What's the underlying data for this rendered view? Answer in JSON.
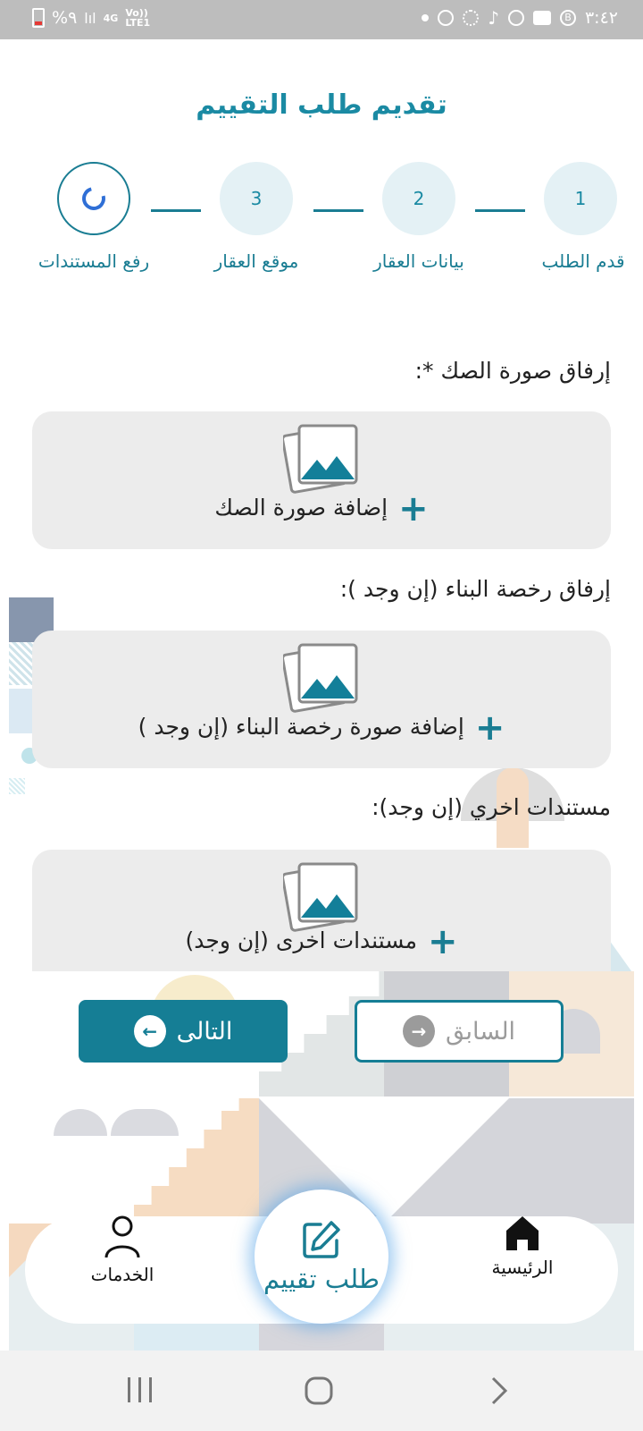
{
  "status_bar": {
    "time": "٣:٤٢",
    "battery": "%٩",
    "network_top": "4G",
    "network_bottom": "Vo)) LTE1"
  },
  "page": {
    "title": "تقديم طلب التقييم"
  },
  "stepper": {
    "steps": [
      {
        "number": "1",
        "label": "قدم الطلب"
      },
      {
        "number": "2",
        "label": "بيانات العقار"
      },
      {
        "number": "3",
        "label": "موقع العقار"
      },
      {
        "number": "",
        "label": "رفع المستندات"
      }
    ]
  },
  "uploads": [
    {
      "label": "إرفاق صورة الصك *:",
      "button": "إضافة صورة الصك"
    },
    {
      "label": "إرفاق رخصة البناء  (إن وجد ):",
      "button": "إضافة صورة رخصة البناء (إن وجد )"
    },
    {
      "label": "مستندات اخري (إن وجد):",
      "button": "مستندات اخرى (إن وجد)"
    }
  ],
  "buttons": {
    "next": "التالى",
    "previous": "السابق"
  },
  "bottom_nav": {
    "home": "الرئيسية",
    "request": "طلب تقييم",
    "services": "الخدمات"
  },
  "colors": {
    "primary": "#157e95",
    "title": "#1a8aa3",
    "card_bg": "#ececec",
    "step_bg": "#e4f1f5"
  }
}
